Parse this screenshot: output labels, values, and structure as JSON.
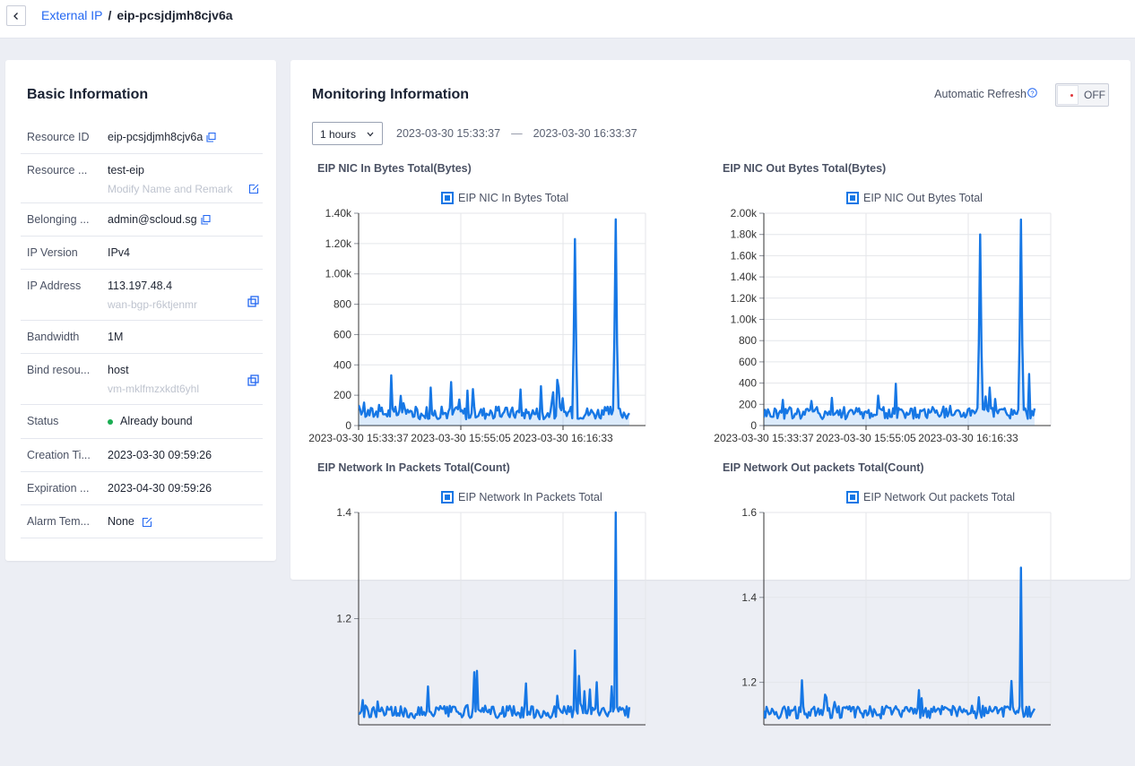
{
  "header": {
    "breadcrumb_parent": "External IP",
    "breadcrumb_separator": "/",
    "breadcrumb_current": "eip-pcsjdjmh8cjv6a"
  },
  "basic": {
    "title": "Basic Information",
    "rows": [
      {
        "label": "Resource ID",
        "value": "eip-pcsjdjmh8cjv6a"
      },
      {
        "label": "Resource ...",
        "value": "test-eip",
        "sub": "Modify Name and Remark"
      },
      {
        "label": "Belonging ...",
        "value": "admin@scloud.sg"
      },
      {
        "label": "IP Version",
        "value": "IPv4"
      },
      {
        "label": "IP Address",
        "value": "113.197.48.4",
        "sub": "wan-bgp-r6ktjenmr"
      },
      {
        "label": "Bandwidth",
        "value": "1M"
      },
      {
        "label": "Bind resou...",
        "value": "host",
        "sub": "vm-mklfmzxkdt6yhl"
      },
      {
        "label": "Status",
        "value": "Already bound"
      },
      {
        "label": "Creation Ti...",
        "value": "2023-03-30 09:59:26"
      },
      {
        "label": "Expiration ...",
        "value": "2023-04-30 09:59:26"
      },
      {
        "label": "Alarm Tem...",
        "value": "None"
      }
    ]
  },
  "monitoring": {
    "title": "Monitoring Information",
    "auto_refresh_label": "Automatic Refresh",
    "toggle_state": "OFF",
    "range_value": "1 hours",
    "start_time": "2023-03-30 15:33:37",
    "end_time": "2023-03-30 16:33:37",
    "range_separator": "—"
  },
  "colors": {
    "accent": "#2468f2",
    "series": "#1677e5",
    "status_ok": "#1aad52",
    "toggle_dot": "#e0373c"
  },
  "chart_data": [
    {
      "type": "area",
      "title": "EIP NIC In Bytes Total(Bytes)",
      "series": [
        {
          "name": "EIP NIC In Bytes Total"
        }
      ],
      "y_ticks": [
        "0",
        "200",
        "400",
        "600",
        "800",
        "1.00k",
        "1.20k",
        "1.40k"
      ],
      "ylim": [
        0,
        1400
      ],
      "x_ticks": [
        "2023-03-30 15:33:37",
        "2023-03-30 15:55:05",
        "2023-03-30 16:16:33"
      ],
      "peaks": [
        {
          "x": 0.8,
          "y": 1230
        },
        {
          "x": 0.95,
          "y": 1360
        }
      ]
    },
    {
      "type": "area",
      "title": "EIP NIC Out Bytes Total(Bytes)",
      "series": [
        {
          "name": "EIP NIC Out Bytes Total"
        }
      ],
      "y_ticks": [
        "0",
        "200",
        "400",
        "600",
        "800",
        "1.00k",
        "1.20k",
        "1.40k",
        "1.60k",
        "1.80k",
        "2.00k"
      ],
      "ylim": [
        0,
        2000
      ],
      "x_ticks": [
        "2023-03-30 15:33:37",
        "2023-03-30 15:55:05",
        "2023-03-30 16:16:33"
      ],
      "peaks": [
        {
          "x": 0.8,
          "y": 1800
        },
        {
          "x": 0.95,
          "y": 1940
        }
      ]
    },
    {
      "type": "line",
      "title": "EIP Network In Packets Total(Count)",
      "series": [
        {
          "name": "EIP Network In Packets Total"
        }
      ],
      "y_ticks": [
        "1.2",
        "1.4"
      ],
      "ylim": [
        1.0,
        1.4
      ],
      "peaks": [
        {
          "x": 0.8,
          "y": 1.14
        },
        {
          "x": 0.95,
          "y": 1.4
        }
      ]
    },
    {
      "type": "line",
      "title": "EIP Network Out packets Total(Count)",
      "series": [
        {
          "name": "EIP Network Out packets Total"
        }
      ],
      "y_ticks": [
        "1.2",
        "1.4",
        "1.6"
      ],
      "ylim": [
        1.1,
        1.6
      ],
      "peaks": [
        {
          "x": 0.95,
          "y": 1.47
        }
      ]
    }
  ]
}
